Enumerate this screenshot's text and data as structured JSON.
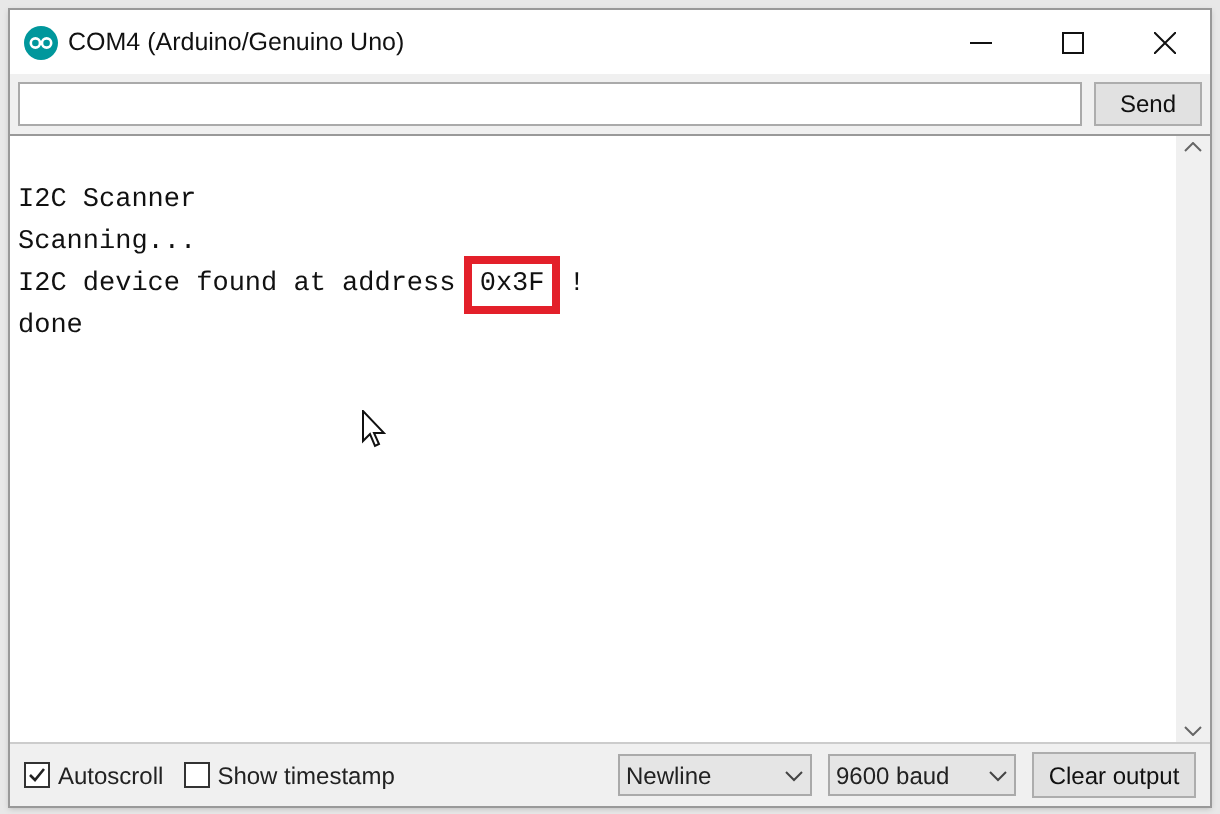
{
  "window": {
    "title": "COM4 (Arduino/Genuino Uno)"
  },
  "send_bar": {
    "button": "Send"
  },
  "output": {
    "lines": [
      {
        "parts": [
          {
            "text": "I2C Scanner",
            "highlighted": false
          }
        ]
      },
      {
        "parts": [
          {
            "text": "Scanning...",
            "highlighted": false
          }
        ]
      },
      {
        "parts": [
          {
            "text": "I2C device found at address ",
            "highlighted": false
          },
          {
            "text": "0x3F",
            "highlighted": true
          },
          {
            "text": " !",
            "highlighted": false
          }
        ]
      },
      {
        "parts": [
          {
            "text": "done",
            "highlighted": false
          }
        ]
      }
    ]
  },
  "status_bar": {
    "autoscroll": {
      "label": "Autoscroll",
      "checked": true
    },
    "timestamp": {
      "label": "Show timestamp",
      "checked": false
    },
    "line_ending": "Newline",
    "baud": "9600 baud",
    "clear_button": "Clear output"
  }
}
